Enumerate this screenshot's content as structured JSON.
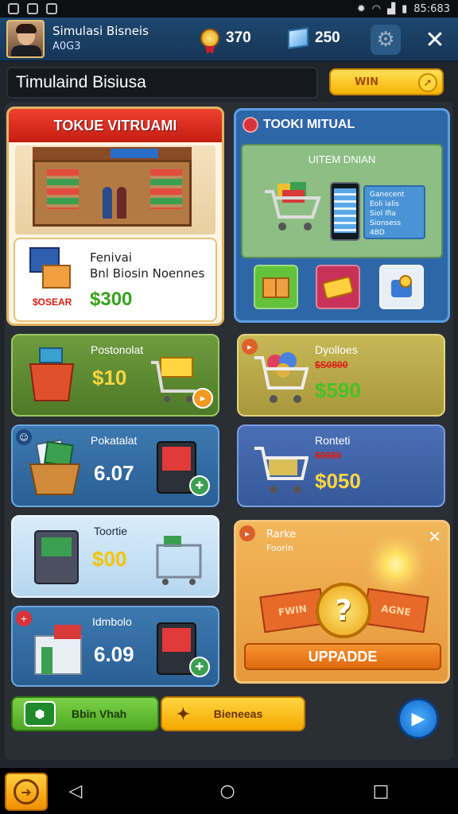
{
  "status_bar": {
    "time": "85:683"
  },
  "header": {
    "player_name": "Simulasi Bisneis",
    "player_sub": "A0G3",
    "currency_medal": "370",
    "currency_cube": "250"
  },
  "title_bar": {
    "title": "Timulaind Bisiusa",
    "win_label": "WIN"
  },
  "offline_store": {
    "heading": "TOKUE VITRUAMI",
    "line1": "Fenivai",
    "line2": "Bnl Biosin Noennes",
    "price": "$300",
    "tag": "$OSEAR"
  },
  "online_store": {
    "heading": "TOOKI MITUAL",
    "subheading": "UITEM DNIAN",
    "screen_lines": [
      "Ganecent",
      "Eoli ialis",
      "Siol lfia",
      "Sionsess",
      "4BD"
    ]
  },
  "cards": [
    {
      "name": "Postonolat",
      "price": "$10"
    },
    {
      "name": "Dyolloes",
      "strike": "$S0800",
      "price": "$590"
    },
    {
      "name": "Pokatalat",
      "price": "6.07"
    },
    {
      "name": "Ronteti",
      "strike": "$0080",
      "price": "$050"
    },
    {
      "name": "Toortie",
      "price": "$00"
    },
    {
      "name": "Idmbolo",
      "price": "6.09"
    }
  ],
  "upgrade_panel": {
    "line1": "Rarke",
    "line2": "Foorin",
    "left_ribbon": "FWIN",
    "right_ribbon": "AGNE",
    "coin": "?",
    "button": "UPPADDE"
  },
  "bottom": {
    "left_label": "Bbin Vhah",
    "mid_label": "Bieneeas"
  },
  "colors": {
    "accent_yellow": "#f5b400",
    "brand_blue": "#2e67a8",
    "offline_red": "#d62014"
  }
}
